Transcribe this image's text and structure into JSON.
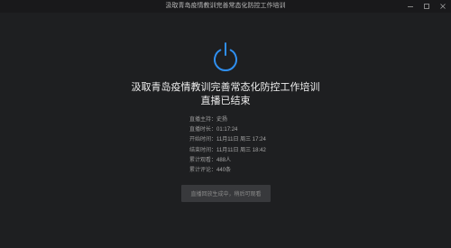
{
  "window": {
    "title": "汲取青岛疫情教训完善常态化防控工作培训"
  },
  "power_icon": "power-icon",
  "headline": {
    "title": "汲取青岛疫情教训完善常态化防控工作培训",
    "status": "直播已结束"
  },
  "info": [
    {
      "label": "直播主持：",
      "value": "史扬"
    },
    {
      "label": "直播时长：",
      "value": "01:17:24"
    },
    {
      "label": "开始时间：",
      "value": "11月11日 周三 17:24"
    },
    {
      "label": "结束时间：",
      "value": "11月11日 周三 18:42"
    },
    {
      "label": "累计观看：",
      "value": "488人"
    },
    {
      "label": "累计评论：",
      "value": "440条"
    }
  ],
  "replay_button": "直播回放生成中，稍后可观看",
  "colors": {
    "background": "#1e1f21",
    "accent": "#2f8ff0",
    "button": "#38393c"
  }
}
